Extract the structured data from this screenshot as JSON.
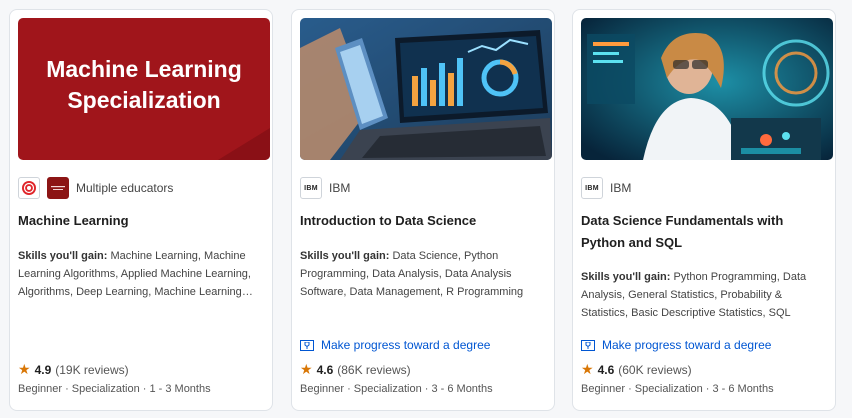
{
  "cards": [
    {
      "thumbnail_text": [
        "Machine Learning",
        "Specialization"
      ],
      "partner_name": "Multiple educators",
      "title": "Machine Learning",
      "skills_label": "Skills you'll gain:",
      "skills": " Machine Learning, Machine Learning Algorithms, Applied Machine Learning, Algorithms, Deep Learning, Machine Learning Methods",
      "rating": "4.9",
      "reviews": "(19K reviews)",
      "meta": "Beginner · Specialization · 1 - 3 Months"
    },
    {
      "partner_logo": "IBM",
      "partner_name": "IBM",
      "title": "Introduction to Data Science",
      "skills_label": "Skills you'll gain:",
      "skills": " Data Science, Python Programming, Data Analysis, Data Analysis Software, Data Management, R Programming",
      "degree_link": "Make progress toward a degree",
      "rating": "4.6",
      "reviews": "(86K reviews)",
      "meta": "Beginner · Specialization · 3 - 6 Months"
    },
    {
      "partner_logo": "IBM",
      "partner_name": "IBM",
      "title": "Data Science Fundamentals with Python and SQL",
      "skills_label": "Skills you'll gain:",
      "skills": " Python Programming, Data Analysis, General Statistics, Probability & Statistics, Basic Descriptive Statistics, SQL",
      "degree_link": "Make progress toward a degree",
      "rating": "4.6",
      "reviews": "(60K reviews)",
      "meta": "Beginner · Specialization · 3 - 6 Months"
    }
  ],
  "colors": {
    "link": "#0056d2",
    "star": "#d97706",
    "ml_banner": "#a0151b"
  },
  "icons": [
    "deeplearning-ai-logo-icon",
    "stanford-logo-icon",
    "ibm-logo-icon",
    "degree-icon",
    "star-icon"
  ]
}
